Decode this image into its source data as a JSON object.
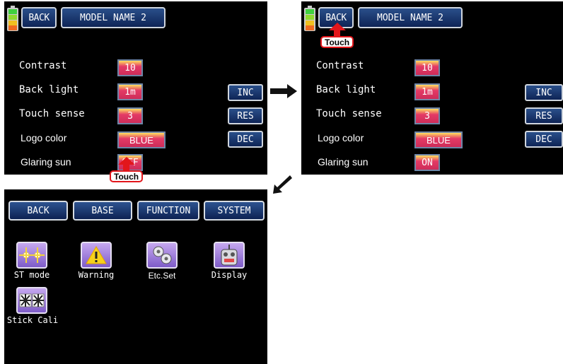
{
  "screen1": {
    "back_label": "BACK",
    "model_name": "MODEL NAME  2",
    "rows": [
      {
        "label": "Contrast",
        "value": "10"
      },
      {
        "label": "Back light",
        "value": "1m"
      },
      {
        "label": "Touch sense",
        "value": "3"
      },
      {
        "label": "Logo color",
        "value": "BLUE"
      },
      {
        "label": "Glaring sun",
        "value": "OFF"
      }
    ],
    "inc": "INC",
    "res": "RES",
    "dec": "DEC",
    "touch": "Touch"
  },
  "screen2": {
    "back_label": "BACK",
    "model_name": "MODEL NAME  2",
    "rows": [
      {
        "label": "Contrast",
        "value": "10"
      },
      {
        "label": "Back light",
        "value": "1m"
      },
      {
        "label": "Touch sense",
        "value": "3"
      },
      {
        "label": "Logo color",
        "value": "BLUE"
      },
      {
        "label": "Glaring sun",
        "value": "ON"
      }
    ],
    "inc": "INC",
    "res": "RES",
    "dec": "DEC",
    "touch": "Touch"
  },
  "screen3": {
    "tabs": [
      "BACK",
      "BASE",
      "FUNCTION",
      "SYSTEM"
    ],
    "apps": [
      {
        "label": "ST mode",
        "icon": "crosshair-sticks-icon"
      },
      {
        "label": "Warning",
        "icon": "warning-icon"
      },
      {
        "label": "Etc.Set",
        "icon": "gears-icon"
      },
      {
        "label": "Display",
        "icon": "transmitter-icon"
      },
      {
        "label": "Stick Cali",
        "icon": "stick-calibration-icon"
      }
    ]
  },
  "colors": {
    "touch_red": "#e2161b",
    "value_pink": "#d42e5c",
    "button_blue": "#1a3a72"
  }
}
